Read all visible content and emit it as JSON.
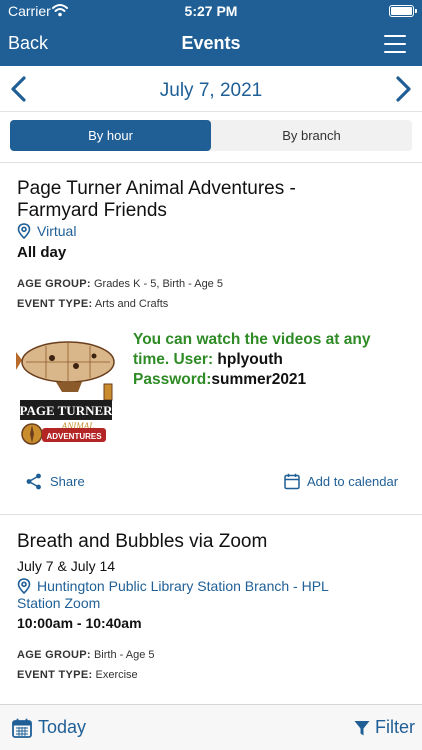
{
  "status_bar": {
    "carrier": "Carrier",
    "time": "5:27 PM"
  },
  "nav": {
    "back_label": "Back",
    "title": "Events"
  },
  "date_bar": {
    "date": "July 7, 2021"
  },
  "segments": {
    "by_hour": "By hour",
    "by_branch": "By branch",
    "selected": "By hour"
  },
  "colors": {
    "brand_blue": "#1f5f96",
    "note_green": "#2e8b25"
  },
  "events": [
    {
      "title_line1": "Page Turner Animal Adventures -",
      "title_line2": "Farmyard Friends",
      "location": "Virtual",
      "time": "All day",
      "age_group_label": "AGE GROUP:",
      "age_group": "Grades K - 5, Birth - Age 5",
      "event_type_label": "EVENT TYPE:",
      "event_type": "Arts and Crafts",
      "note_green1": "You can watch the videos at any time. User:",
      "note_black1": " hplyouth",
      "note_green2": "Password:",
      "note_black2": "summer2021",
      "image_text": {
        "line1": "PAGE TURNER",
        "line2": "ANIMAL",
        "line3": "ADVENTURES"
      },
      "share_label": "Share",
      "calendar_label": "Add to calendar"
    },
    {
      "title": "Breath and Bubbles via Zoom",
      "dates": "July 7 & July 14",
      "location_line1": "Huntington Public Library Station Branch - HPL",
      "location_line2": "Station Zoom",
      "time": "10:00am - 10:40am",
      "age_group_label": "AGE GROUP:",
      "age_group": "Birth - Age 5",
      "event_type_label": "EVENT TYPE:",
      "event_type": "Exercise"
    }
  ],
  "toolbar": {
    "today_label": "Today",
    "filter_label": "Filter"
  }
}
